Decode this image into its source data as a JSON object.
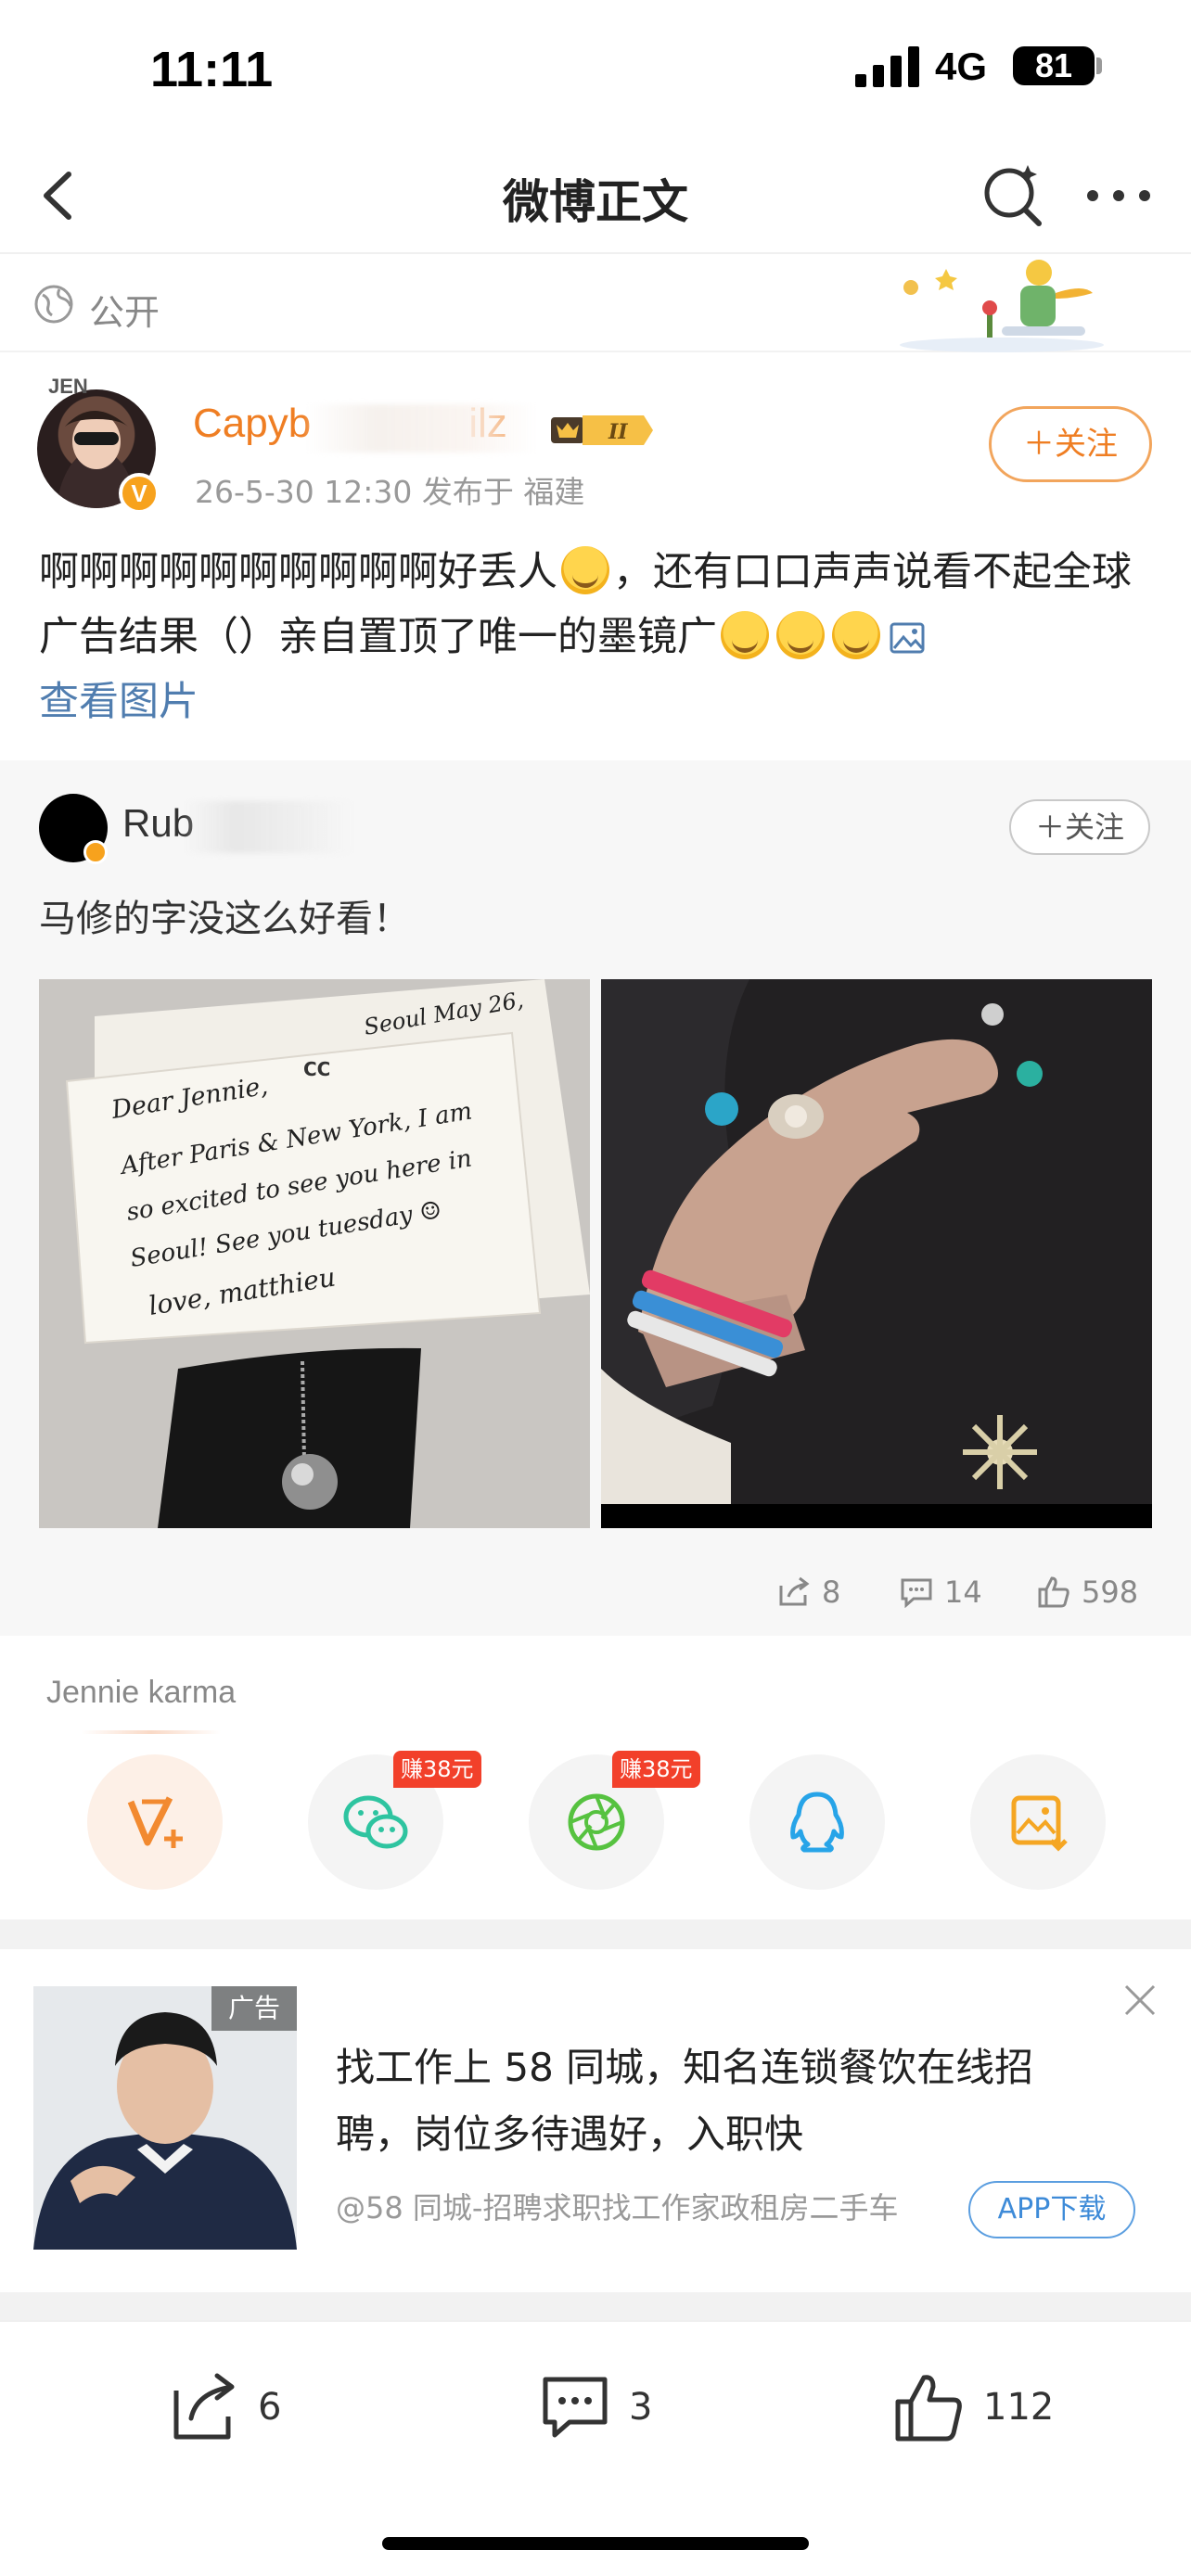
{
  "status_bar": {
    "time": "11:11",
    "network": "4G",
    "battery": "81"
  },
  "nav": {
    "title": "微博正文"
  },
  "visibility": {
    "label": "公开"
  },
  "post": {
    "avatar_tag": "JEN",
    "username": "Capyb",
    "username_tail": "ilz",
    "level": "II",
    "meta": "26-5-30 12:30  发布于 福建",
    "follow_label": "＋关注",
    "text_part1": "啊啊啊啊啊啊啊啊啊啊好丢人",
    "text_part2": "，还有口口声声说看不起全球广告结果（）亲自置顶了唯一的墨镜广",
    "view_pic": "查看图片"
  },
  "repost": {
    "username": "Rub",
    "follow_label": "＋关注",
    "text": "马修的字没这么好看！",
    "letter": {
      "line1": "Seoul May 26,",
      "line2": "Dear Jennie,",
      "line3": "After Paris & New York, I am",
      "line4": "so excited to see you here in",
      "line5": "Seoul! See you tuesday ☺",
      "line6": "love, matthieu"
    },
    "reposts": "8",
    "comments": "14",
    "likes": "598"
  },
  "share": {
    "caption": "Jennie karma",
    "earn_badge_1": "赚38元",
    "earn_badge_2": "赚38元"
  },
  "ad": {
    "tag": "广告",
    "title": "找工作上 58 同城，知名连锁餐饮在线招聘，岗位多待遇好，入职快",
    "source": "@58 同城-招聘求职找工作家政租房二手车",
    "button": "APP下载"
  },
  "bottom_bar": {
    "reposts": "6",
    "comments": "3",
    "likes": "112"
  },
  "colors": {
    "accent_orange": "#ef7e23",
    "link_blue": "#507daf",
    "earn_red": "#f2402a",
    "wechat_green": "#2ec4a0",
    "qq_blue": "#27a4e8"
  }
}
